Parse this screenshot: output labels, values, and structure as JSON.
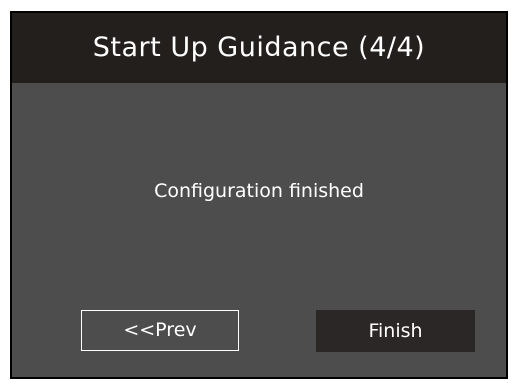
{
  "window": {
    "title": "Start Up Guidance (4/4)"
  },
  "content": {
    "message": "Configuration finished"
  },
  "buttons": {
    "prev_label": "<<Prev",
    "finish_label": "Finish"
  },
  "colors": {
    "title_bar": "#231f1d",
    "dialog_background": "#4d4d4d",
    "finish_button": "#2b2726",
    "text": "#ffffff"
  }
}
